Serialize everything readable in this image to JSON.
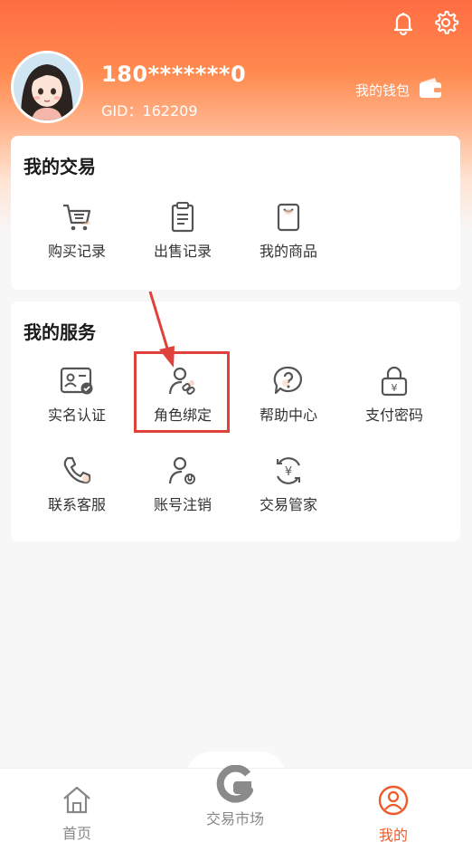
{
  "header": {
    "phone": "180*******0",
    "gid": "GID：162209",
    "wallet_label": "我的钱包"
  },
  "trade": {
    "title": "我的交易",
    "items": [
      {
        "label": "购买记录",
        "icon": "cart-icon"
      },
      {
        "label": "出售记录",
        "icon": "clipboard-icon"
      },
      {
        "label": "我的商品",
        "icon": "product-bag-icon"
      }
    ]
  },
  "services": {
    "title": "我的服务",
    "items": [
      {
        "label": "实名认证",
        "icon": "id-card-verified-icon"
      },
      {
        "label": "角色绑定",
        "icon": "user-link-icon"
      },
      {
        "label": "帮助中心",
        "icon": "help-icon"
      },
      {
        "label": "支付密码",
        "icon": "lock-yen-icon"
      },
      {
        "label": "联系客服",
        "icon": "phone-icon"
      },
      {
        "label": "账号注销",
        "icon": "user-power-icon"
      },
      {
        "label": "交易管家",
        "icon": "yen-cycle-icon"
      }
    ]
  },
  "tabbar": {
    "home": "首页",
    "market": "交易市场",
    "mine": "我的"
  },
  "colors": {
    "accent": "#f05a28",
    "highlight": "#e0413b"
  }
}
